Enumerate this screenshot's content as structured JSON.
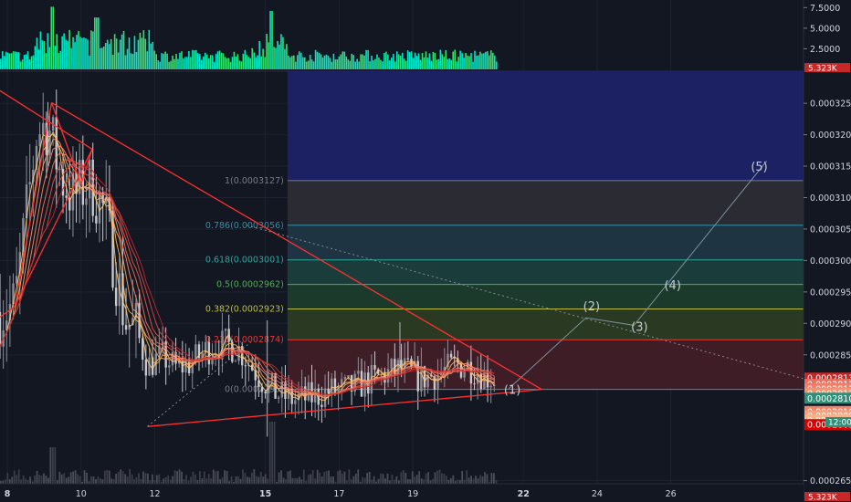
{
  "chart_data": {
    "type": "candlestick",
    "title": "",
    "xlabel": "",
    "ylabel": "",
    "x_ticks": [
      {
        "label": "8",
        "day": 8
      },
      {
        "label": "10",
        "day": 10
      },
      {
        "label": "12",
        "day": 12
      },
      {
        "label": "15",
        "day": 15
      },
      {
        "label": "17",
        "day": 17
      },
      {
        "label": "19",
        "day": 19
      },
      {
        "label": "22",
        "day": 22
      },
      {
        "label": "24",
        "day": 24
      },
      {
        "label": "26",
        "day": 26
      }
    ],
    "bold_ticks": [
      "8",
      "15",
      "22"
    ],
    "x_range": [
      7.8,
      29.6
    ],
    "price_range": [
      0.0002645,
      0.0003301
    ],
    "price_ticks": [
      "0.0003250",
      "0.0003200",
      "0.0003150",
      "0.0003100",
      "0.0003050",
      "0.0003000",
      "0.0002950",
      "0.0002900",
      "0.0002850",
      "0.0002650"
    ],
    "volume_range": [
      0,
      8.2
    ],
    "volume_ticks": [
      "7.5000",
      "5.0000",
      "2.5000"
    ],
    "volume_last_label": "5.323K",
    "bottom_volume_label": "5.323K",
    "time_label": "12:00",
    "price_badges": [
      {
        "text": "0.0002813",
        "color": "#c62828",
        "price": 0.0002813
      },
      {
        "text": "0.0002812",
        "color": "#e57363",
        "price": 0.0002803
      },
      {
        "text": "0.0002812",
        "color": "#ef7f6c",
        "price": 0.0002796
      },
      {
        "text": "0.0002811",
        "color": "#f5926f",
        "price": 0.0002789
      },
      {
        "text": "0.0002810",
        "color": "#2e8f79",
        "price": 0.0002781
      },
      {
        "text": "0.0002810",
        "color": "#f28469",
        "price": 0.000276
      },
      {
        "text": "0.0002809",
        "color": "#f6a27c",
        "price": 0.0002753
      },
      {
        "text": "0.0002808",
        "color": "#f8b28a",
        "price": 0.0002746
      },
      {
        "text": "0.0002805",
        "color": "#d50000",
        "price": 0.0002739
      }
    ],
    "fib_x_start": 15.6,
    "fib_levels": [
      {
        "level": 1,
        "label": "1(0.0003127)",
        "price": 0.0003127,
        "color": "#787b86",
        "fill": "#2a2b33"
      },
      {
        "level": 0.786,
        "label": "0.786(0.0003056)",
        "price": 0.0003056,
        "color": "#2f8fa8",
        "fill": "#1f3442"
      },
      {
        "level": 0.618,
        "label": "0.618(0.0003001)",
        "price": 0.0003001,
        "color": "#26a69a",
        "fill": "#1a3d3c"
      },
      {
        "level": 0.5,
        "label": "0.5(0.0002962)",
        "price": 0.0002962,
        "color": "#4caf50",
        "fill": "#1c3a2c"
      },
      {
        "level": 0.382,
        "label": "0.382(0.0002923)",
        "price": 0.0002923,
        "color": "#bdbd3a",
        "fill": "#2a3a22"
      },
      {
        "level": 0.236,
        "label": "0.236(0.0002874)",
        "price": 0.0002874,
        "color": "#e53935",
        "fill": "#3f1d26"
      },
      {
        "level": 0,
        "label": "0(0.0002795)",
        "price": 0.0002795,
        "color": "#787b86",
        "fill": "#3a1a24"
      }
    ],
    "fib_top_zone": {
      "price_top": 0.0003301,
      "price_bottom": 0.0003127,
      "fill": "#1c2163"
    },
    "wave_labels": [
      {
        "text": "(1)",
        "day": 21.7,
        "price": 0.0002788
      },
      {
        "text": "(2)",
        "day": 23.85,
        "price": 0.0002921
      },
      {
        "text": "(3)",
        "day": 25.15,
        "price": 0.0002888
      },
      {
        "text": "(4)",
        "day": 26.05,
        "price": 0.0002954
      },
      {
        "text": "(5)",
        "day": 28.4,
        "price": 0.0003143
      }
    ],
    "wave_path": [
      {
        "day": 21.6,
        "price": 0.0002796
      },
      {
        "day": 23.7,
        "price": 0.0002909
      },
      {
        "day": 25.0,
        "price": 0.0002897
      },
      {
        "day": 28.6,
        "price": 0.0003158
      }
    ],
    "triangle_lines": [
      {
        "from": {
          "day": 9.2,
          "price": 0.0003251
        },
        "to": {
          "day": 22.5,
          "price": 0.0002795
        }
      },
      {
        "from": {
          "day": 11.8,
          "price": 0.0002736
        },
        "to": {
          "day": 22.5,
          "price": 0.0002795
        }
      },
      {
        "from": {
          "day": 9.2,
          "price": 0.0003251
        },
        "to": {
          "day": 8.2,
          "price": 0.0002927
        }
      },
      {
        "from": {
          "day": 8.2,
          "price": 0.0002927
        },
        "to": {
          "day": 7.8,
          "price": 0.000291
        }
      },
      {
        "from": {
          "day": 8.2,
          "price": 0.0002927
        },
        "to": {
          "day": 10.3,
          "price": 0.0003177
        }
      },
      {
        "from": {
          "day": 9.2,
          "price": 0.0003251
        },
        "to": {
          "day": 10.0,
          "price": 0.0003121
        }
      },
      {
        "from": {
          "day": 10.0,
          "price": 0.0003121
        },
        "to": {
          "day": 10.3,
          "price": 0.0003177
        }
      },
      {
        "from": {
          "day": 10.3,
          "price": 0.0003177
        },
        "to": {
          "day": 7.8,
          "price": 0.000327
        }
      }
    ],
    "dotted_lines": [
      {
        "from": {
          "day": 11.8,
          "price": 0.0002736
        },
        "to": {
          "day": 14.6,
          "price": 0.000287
        }
      },
      {
        "from": {
          "day": 14.5,
          "price": 0.0003056
        },
        "to": {
          "day": 29.6,
          "price": 0.0002812
        }
      }
    ],
    "price_anchors": [
      [
        7.8,
        0.0002918
      ],
      [
        8.2,
        0.000293
      ],
      [
        8.5,
        0.0003065
      ],
      [
        8.8,
        0.0003205
      ],
      [
        9.1,
        0.0003218
      ],
      [
        9.3,
        0.0003168
      ],
      [
        9.5,
        0.0003128
      ],
      [
        9.8,
        0.0003098
      ],
      [
        10.0,
        0.0003115
      ],
      [
        10.3,
        0.000312
      ],
      [
        10.6,
        0.000308
      ],
      [
        10.9,
        0.0003
      ],
      [
        11.0,
        0.0002965
      ],
      [
        11.2,
        0.0002905
      ],
      [
        11.5,
        0.0002888
      ],
      [
        11.8,
        0.0002833
      ],
      [
        12.2,
        0.0002848
      ],
      [
        12.6,
        0.0002828
      ],
      [
        13.0,
        0.0002838
      ],
      [
        13.4,
        0.0002858
      ],
      [
        13.9,
        0.0002868
      ],
      [
        14.3,
        0.0002858
      ],
      [
        14.8,
        0.0002818
      ],
      [
        15.3,
        0.0002788
      ],
      [
        15.8,
        0.0002778
      ],
      [
        16.3,
        0.0002783
      ],
      [
        16.8,
        0.0002793
      ],
      [
        17.3,
        0.0002796
      ],
      [
        17.8,
        0.0002808
      ],
      [
        18.2,
        0.0002818
      ],
      [
        18.7,
        0.0002828
      ],
      [
        19.2,
        0.0002812
      ],
      [
        19.7,
        0.000282
      ],
      [
        20.2,
        0.0002835
      ],
      [
        20.6,
        0.000283
      ],
      [
        21.0,
        0.0002816
      ],
      [
        21.3,
        0.000281
      ]
    ],
    "candle_count": 150
  }
}
